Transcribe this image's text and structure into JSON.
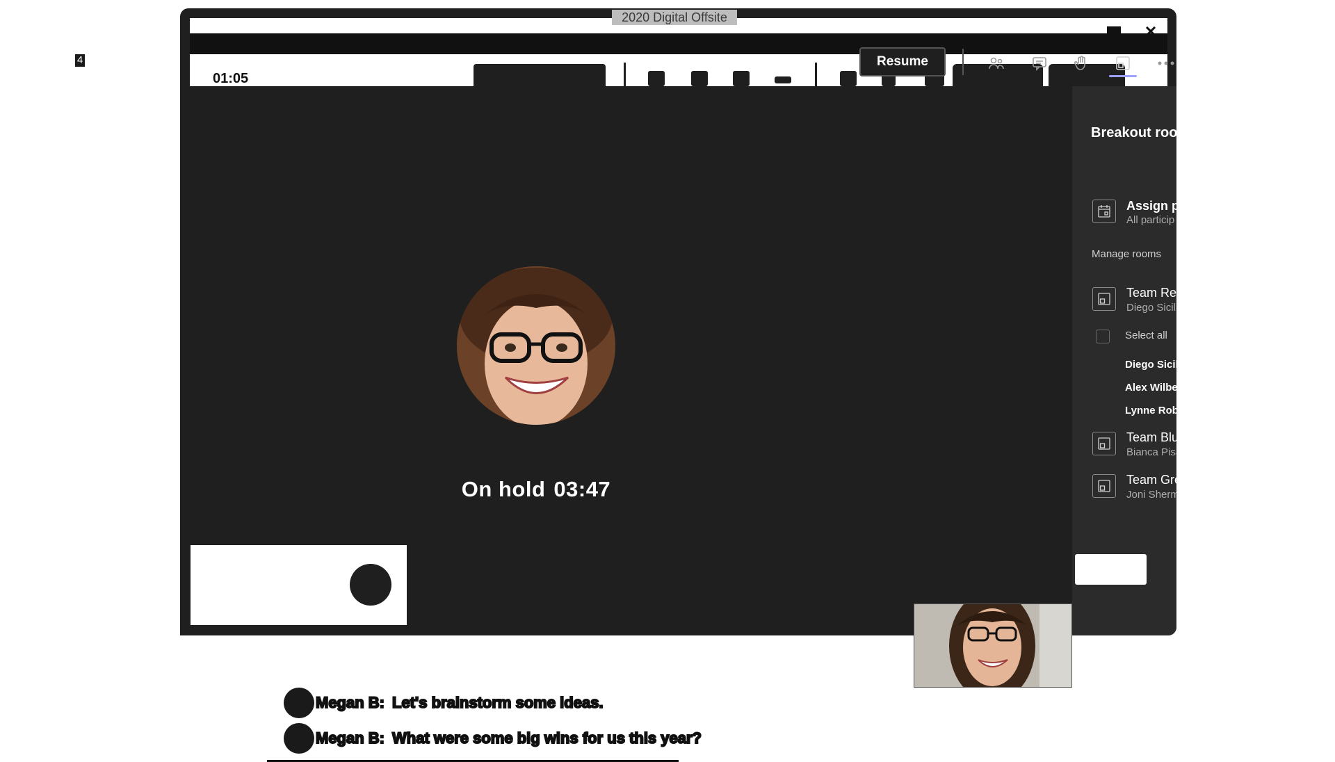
{
  "stray_number": "4",
  "window": {
    "title": "2020 Digital Offsite"
  },
  "call": {
    "timer": "01:05",
    "resume_label": "Resume",
    "status": "On hold",
    "hold_time": "03:47"
  },
  "toolbar": {
    "icons": [
      "people-icon",
      "chat-icon",
      "raise-hand-icon",
      "breakout-rooms-icon",
      "more-options-icon"
    ]
  },
  "breakout_panel": {
    "title": "Breakout rooms",
    "assign": {
      "label": "Assign pa",
      "sub": "All particip"
    },
    "manage_label": "Manage rooms",
    "rooms": [
      {
        "name": "Team Red",
        "sub": "Diego Sicili"
      },
      {
        "name": "Team Blue",
        "sub": "Bianca Pisa"
      },
      {
        "name": "Team Green",
        "sub": "Joni Sherm"
      }
    ],
    "select_all": "Select all",
    "members": [
      "Diego Sicili",
      "Alex Wilbe",
      "Lynne Robb"
    ]
  },
  "chat": [
    {
      "name": "Megan B:",
      "message": "Let's brainstorm some ideas."
    },
    {
      "name": "Megan B:",
      "message": "What were some big wins for us this year?"
    }
  ]
}
